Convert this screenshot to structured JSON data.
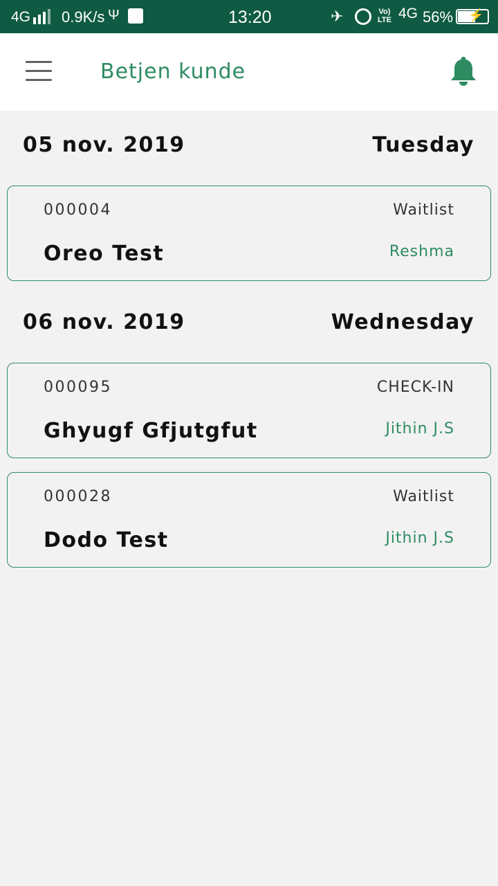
{
  "status_bar": {
    "network": "4G",
    "speed": "0.9K/s",
    "time": "13:20",
    "volte_top": "Vo)",
    "volte_bottom": "LTE",
    "data_type": "4G",
    "battery_pct": "56%",
    "battery_level": 0.56
  },
  "app_bar": {
    "title": "Betjen kunde",
    "menu_icon": "hamburger-menu-icon",
    "notification_icon": "bell-icon",
    "accent_color": "#2e8b62"
  },
  "groups": [
    {
      "date": "05 nov. 2019",
      "weekday": "Tuesday",
      "entries": [
        {
          "id": "000004",
          "status": "Waitlist",
          "name": "Oreo Test",
          "staff": "Reshma"
        }
      ]
    },
    {
      "date": "06 nov. 2019",
      "weekday": "Wednesday",
      "entries": [
        {
          "id": "000095",
          "status": "CHECK-IN",
          "name": "Ghyugf Gfjutgfut",
          "staff": "Jithin J.S"
        },
        {
          "id": "000028",
          "status": "Waitlist",
          "name": "Dodo Test",
          "staff": "Jithin J.S"
        }
      ]
    }
  ]
}
